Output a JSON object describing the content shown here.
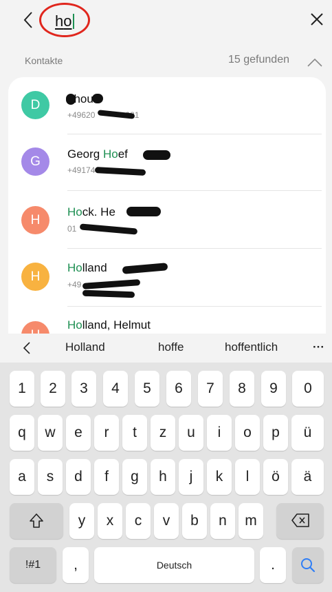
{
  "search": {
    "query_prefix": "h",
    "query_rest": "o"
  },
  "section": {
    "title": "Kontakte",
    "found": "15 gefunden"
  },
  "contacts": [
    {
      "initial": "D",
      "name_before": "",
      "name_highlight": "",
      "name_visible": "ehou",
      "name_after": "",
      "number": "+49620",
      "number_tail": "281",
      "color": "#3fc9a4"
    },
    {
      "initial": "G",
      "name_before": "Georg ",
      "name_highlight": "Ho",
      "name_after": "ef",
      "number": "+49174",
      "number_tail": "",
      "color": "#a489e8"
    },
    {
      "initial": "H",
      "name_before": "",
      "name_highlight": "Ho",
      "name_after": "ck. He",
      "number": "01",
      "number_tail": "",
      "color": "#f68a6b"
    },
    {
      "initial": "H",
      "name_before": "",
      "name_highlight": "Ho",
      "name_after": "lland ",
      "number": "+49",
      "number_tail": "",
      "color": "#f8b240"
    },
    {
      "initial": "H",
      "name_before": "",
      "name_highlight": "Ho",
      "name_after": "lland, Helmut",
      "number": "",
      "number_tail": "",
      "color": "#f68a6b"
    }
  ],
  "suggestions": [
    "Holland",
    "hoffe",
    "hoffentlich"
  ],
  "suggestions_more": "···",
  "keyboard": {
    "row_numbers": [
      "1",
      "2",
      "3",
      "4",
      "5",
      "6",
      "7",
      "8",
      "9",
      "0"
    ],
    "row_q": [
      "q",
      "w",
      "e",
      "r",
      "t",
      "z",
      "u",
      "i",
      "o",
      "p",
      "ü"
    ],
    "row_a": [
      "a",
      "s",
      "d",
      "f",
      "g",
      "h",
      "j",
      "k",
      "l",
      "ö",
      "ä"
    ],
    "row_y": [
      "y",
      "x",
      "c",
      "v",
      "b",
      "n",
      "m"
    ],
    "symbols_label": "!#1",
    "comma_label": ",",
    "space_label": "Deutsch",
    "period_label": "."
  },
  "colors": {
    "highlight": "#1d8f52",
    "search_key": "#2f7ef6",
    "annotation_circle": "#e0261d"
  }
}
